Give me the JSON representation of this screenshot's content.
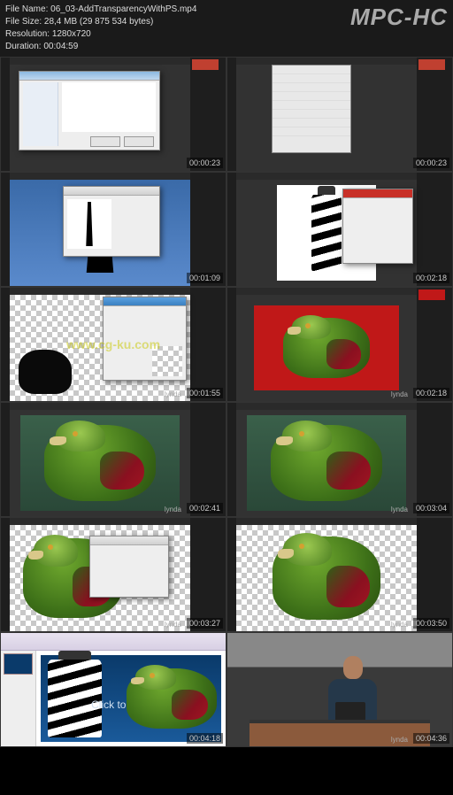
{
  "header": {
    "file_name_label": "File Name:",
    "file_name": "06_03-AddTransparencyWithPS.mp4",
    "size_label": "File Size:",
    "size": "28,4 MB (29 875 534 bytes)",
    "resolution_label": "Resolution:",
    "resolution": "1280x720",
    "duration_label": "Duration:",
    "duration": "00:04:59",
    "player": "MPC-HC"
  },
  "thumbs": [
    {
      "ts": "00:00:23",
      "type": "ps-filedialog"
    },
    {
      "ts": "00:00:23",
      "type": "ps-menu"
    },
    {
      "ts": "00:01:09",
      "type": "ps-lighthouse-sil"
    },
    {
      "ts": "00:02:18",
      "type": "ps-lighthouse-white"
    },
    {
      "ts": "00:01:55",
      "type": "ps-checker-obj",
      "wm": "lynda",
      "cg": "www.cg-ku.com"
    },
    {
      "ts": "00:02:18",
      "type": "ps-parrot-red",
      "wm": "lynda"
    },
    {
      "ts": "00:02:41",
      "type": "ps-parrot-green",
      "wm": "lynda"
    },
    {
      "ts": "00:03:04",
      "type": "ps-parrot-green",
      "wm": "lynda"
    },
    {
      "ts": "00:03:27",
      "type": "ps-parrot-checker-dialog",
      "wm": "lynda"
    },
    {
      "ts": "00:03:50",
      "type": "ps-parrot-checker",
      "wm": "lynda"
    },
    {
      "ts": "00:04:18",
      "type": "ppt",
      "slide_text": "Click to add tit"
    },
    {
      "ts": "00:04:36",
      "type": "presenter",
      "wm": "lynda"
    }
  ],
  "slide": {
    "placeholder": "Click to add tit"
  }
}
